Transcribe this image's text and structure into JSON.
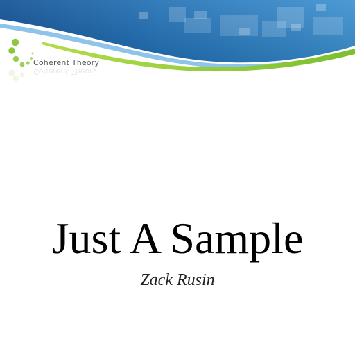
{
  "slide": {
    "brand_name": "Coherent Theory",
    "title": "Just A Sample",
    "subtitle": "Zack Rusin"
  },
  "theme": {
    "banner_blue": "#1f6fb4",
    "banner_light_blue": "#5aa8dd",
    "swoosh_green": "#8cc63f",
    "logo_green": "#8dc63f",
    "background": "#ffffff"
  },
  "icons": {
    "logo": "dotted-arc-logo-icon"
  }
}
